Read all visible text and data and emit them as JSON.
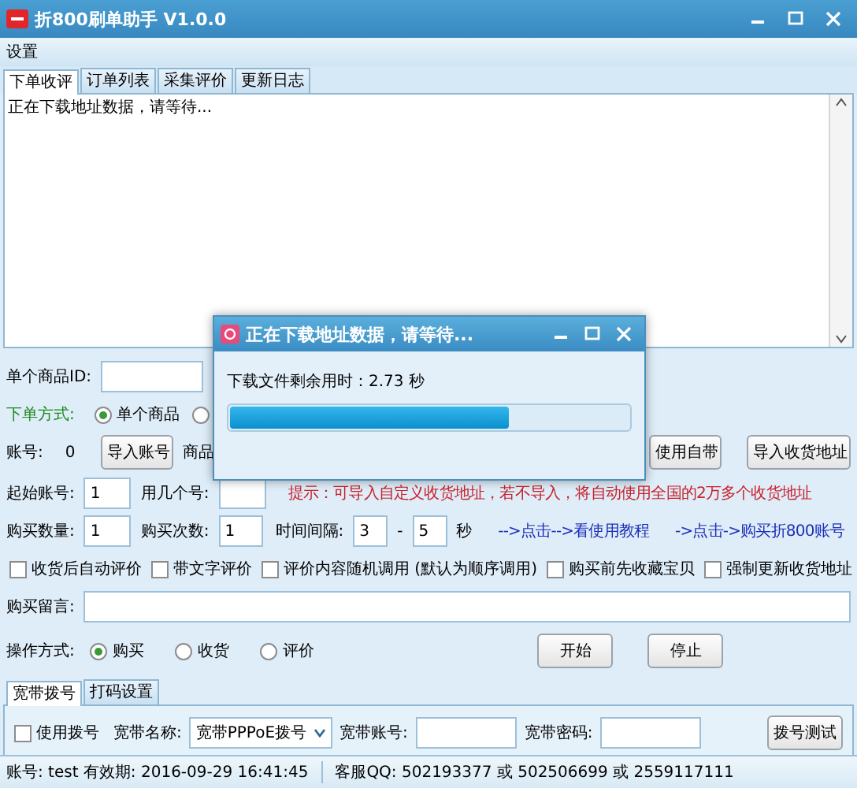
{
  "window": {
    "title": "折800刷单助手 V1.0.0"
  },
  "menu": [
    "设置"
  ],
  "tabs": [
    {
      "label": "下单收评",
      "selected": true
    },
    {
      "label": "订单列表",
      "selected": false
    },
    {
      "label": "采集评价",
      "selected": false
    },
    {
      "label": "更新日志",
      "selected": false
    }
  ],
  "log": {
    "text": "正在下载地址数据，请等待..."
  },
  "dialog": {
    "title": "正在下载地址数据，请等待...",
    "message": "下载文件剩余用时：2.73 秒",
    "level": 0.7
  },
  "form": {
    "product_id_label": "单个商品ID:",
    "order_mode": {
      "label": "下单方式:",
      "options": [
        {
          "label": "单个商品",
          "selected": true
        },
        {
          "selected": false
        }
      ]
    },
    "account_label": "账号:",
    "account_count": "0",
    "import_account_button": "导入账号",
    "goods_label": "商品",
    "address_buttons": [
      "使用自带",
      "导入收货地址"
    ],
    "start_account": {
      "label": "起始账号:",
      "value": "1"
    },
    "use_count": {
      "label": "用几个号:"
    },
    "hint": "提示：可导入自定义收货地址，若不导入，将自动使用全国的2万多个收货地址",
    "quantity": {
      "label": "购买数量:",
      "value": "1"
    },
    "times": {
      "label": "购买次数:",
      "value": "1"
    },
    "interval": {
      "label": "时间间隔:",
      "from": "3",
      "separator": "-",
      "to": "5",
      "unit": "秒"
    },
    "links": [
      "-->点击-->看使用教程",
      "->点击->购买折800账号"
    ],
    "checkboxes": [
      {
        "label": "收货后自动评价",
        "checked": false
      },
      {
        "label": "带文字评价",
        "checked": false
      },
      {
        "label": "评价内容随机调用 (默认为顺序调用)",
        "checked": false
      },
      {
        "label": "购买前先收藏宝贝",
        "checked": false
      },
      {
        "label": "强制更新收货地址",
        "checked": false
      }
    ],
    "message_label": "购买留言:",
    "operation": {
      "label": "操作方式:",
      "options": [
        {
          "label": "购买",
          "selected": true
        },
        {
          "label": "收货",
          "selected": false
        },
        {
          "label": "评价",
          "selected": false
        }
      ]
    },
    "action_buttons": [
      "开始",
      "停止"
    ]
  },
  "bottom_tabs": [
    {
      "label": "宽带拨号",
      "selected": true
    },
    {
      "label": "打码设置",
      "selected": false
    }
  ],
  "dial": {
    "use_dial": {
      "label": "使用拨号",
      "checked": false
    },
    "name_label": "宽带名称:",
    "name_value": "宽带PPPoE拨号",
    "account_label": "宽带账号:",
    "password_label": "宽带密码:",
    "test_button": "拨号测试"
  },
  "status_bar": [
    "账号: test 有效期: 2016-09-29 16:41:45",
    "客服QQ: 502193377 或 502506699 或 2559117111"
  ]
}
